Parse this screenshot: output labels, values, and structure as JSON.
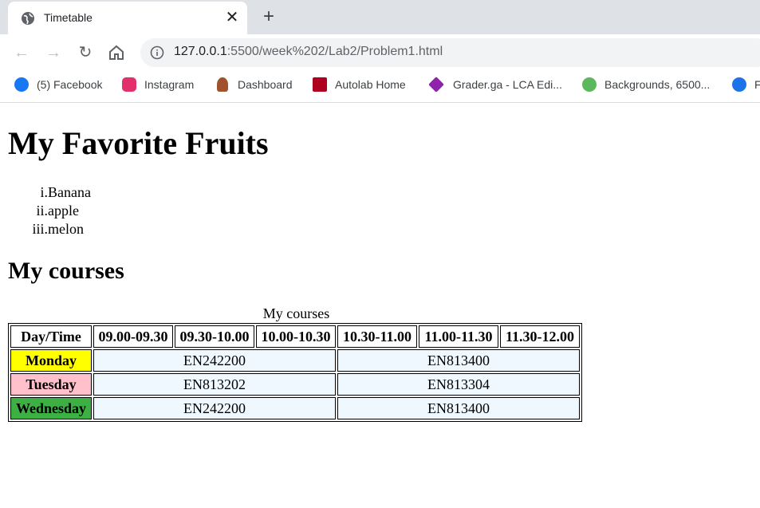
{
  "browser": {
    "tab": {
      "title": "Timetable",
      "icon": "globe-icon"
    },
    "toolbar": {
      "url_host": "127.0.0.1",
      "url_path": ":5500/week%202/Lab2/Problem1.html"
    },
    "bookmarks": [
      {
        "label": "(5) Facebook",
        "icon": "facebook-icon",
        "color": "#1877f2"
      },
      {
        "label": "Instagram",
        "icon": "instagram-icon",
        "color": "#e1306c"
      },
      {
        "label": "Dashboard",
        "icon": "dashboard-icon",
        "color": "#a0522d"
      },
      {
        "label": "Autolab Home",
        "icon": "autolab-icon",
        "color": "#b00020"
      },
      {
        "label": "Grader.ga - LCA Edi...",
        "icon": "grader-icon",
        "color": "#8e24aa"
      },
      {
        "label": "Backgrounds, 6500...",
        "icon": "backgrounds-icon",
        "color": "#5cb85c"
      },
      {
        "label": "F",
        "icon": "robot-icon",
        "color": "#1a73e8"
      }
    ]
  },
  "page": {
    "heading": "My Favorite Fruits",
    "fruits": [
      {
        "num": "i.",
        "text": "Banana"
      },
      {
        "num": "ii.",
        "text": "apple"
      },
      {
        "num": "iii.",
        "text": "melon"
      }
    ],
    "courses_heading": "My courses",
    "table": {
      "caption": "My courses",
      "headers": [
        "Day/Time",
        "09.00-09.30",
        "09.30-10.00",
        "10.00-10.30",
        "10.30-11.00",
        "11.00-11.30",
        "11.30-12.00"
      ],
      "rows": [
        {
          "day": "Monday",
          "color": "#ffff00",
          "slot1": "EN242200",
          "slot2": "EN813400"
        },
        {
          "day": "Tuesday",
          "color": "#ffc0cb",
          "slot1": "EN813202",
          "slot2": "EN813304"
        },
        {
          "day": "Wednesday",
          "color": "#3cb043",
          "slot1": "EN242200",
          "slot2": "EN813400"
        }
      ]
    }
  }
}
